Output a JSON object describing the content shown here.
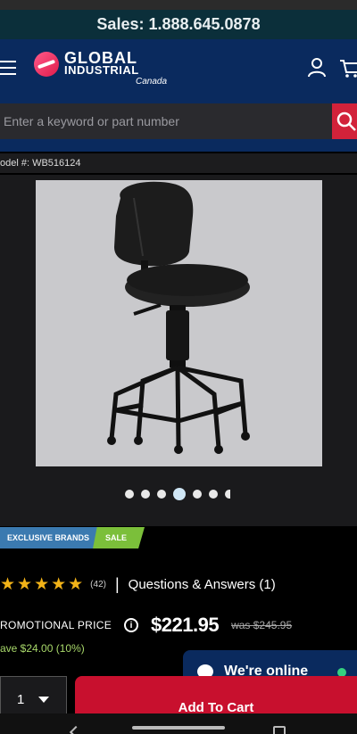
{
  "sales": {
    "text": "Sales: 1.888.645.0878"
  },
  "header": {
    "logo_line1": "GLOBAL",
    "logo_line2": "INDUSTRIAL",
    "logo_region": "Canada"
  },
  "search": {
    "placeholder": "Enter a keyword or part number"
  },
  "product": {
    "model": "odel #: WB516124",
    "image_alt": "Black vinyl task stool",
    "carousel": {
      "count": 7,
      "active_index": 3
    },
    "badges": [
      "EXCLUSIVE BRANDS",
      "SALE"
    ],
    "rating": {
      "stars": 5,
      "count": "(42)"
    },
    "qa_link": "Questions & Answers (1)",
    "promo_label": "ROMOTIONAL PRICE",
    "price": "$221.95",
    "was_price": "was $245.95",
    "savings": "ave $24.00 (10%)"
  },
  "chat": {
    "label": "We're online"
  },
  "purchase": {
    "quantity": "1",
    "add_to_cart": "Add To Cart"
  },
  "colors": {
    "brand_navy": "#0a2a5e",
    "accent_red": "#c8102e",
    "star": "#f2b318",
    "save_green": "#a8d86a",
    "online_green": "#35d07f"
  }
}
